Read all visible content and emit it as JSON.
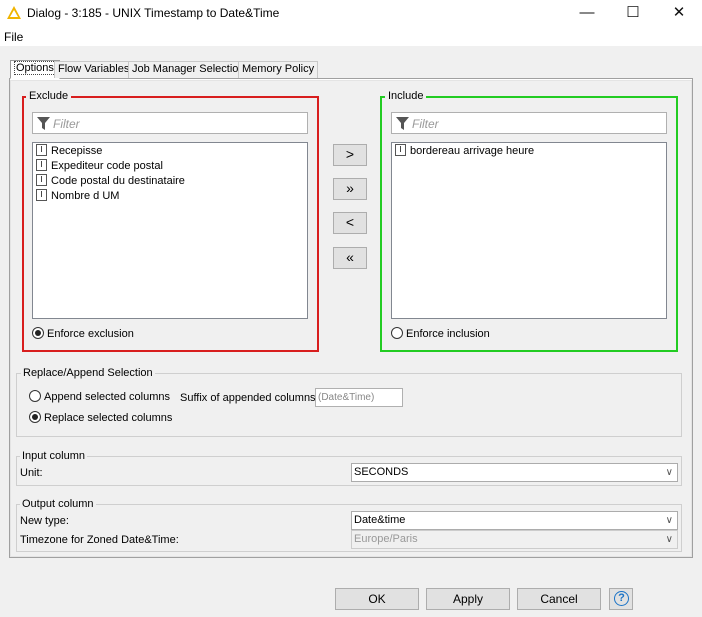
{
  "window": {
    "title": "Dialog - 3:185 - UNIX Timestamp to Date&Time",
    "minimize_glyph": "—",
    "maximize_glyph": "☐",
    "close_glyph": "✕"
  },
  "menu": {
    "file": "File"
  },
  "tabs": [
    {
      "label": "Options",
      "active": true
    },
    {
      "label": "Flow Variables",
      "active": false
    },
    {
      "label": "Job Manager Selection",
      "active": false
    },
    {
      "label": "Memory Policy",
      "active": false
    }
  ],
  "exclude": {
    "legend": "Exclude",
    "filter_placeholder": "Filter",
    "items": [
      "Recepisse",
      "Expediteur code postal",
      "Code postal du destinataire",
      "Nombre d UM"
    ],
    "enforce_label": "Enforce exclusion",
    "enforce_checked": true,
    "border_color": "#d81e1e"
  },
  "include": {
    "legend": "Include",
    "filter_placeholder": "Filter",
    "items": [
      "bordereau arrivage heure"
    ],
    "enforce_label": "Enforce inclusion",
    "enforce_checked": false,
    "border_color": "#22cc22"
  },
  "column_type_glyph": "I",
  "move_buttons": {
    "add": ">",
    "add_all": "»",
    "remove": "<",
    "remove_all": "«"
  },
  "replace_append": {
    "legend": "Replace/Append Selection",
    "append_label": "Append selected columns",
    "replace_label": "Replace selected columns",
    "selected": "replace",
    "suffix_label": "Suffix of appended columns:",
    "suffix_value": "(Date&Time)"
  },
  "input_column": {
    "legend": "Input column",
    "unit_label": "Unit:",
    "unit_value": "SECONDS"
  },
  "output_column": {
    "legend": "Output column",
    "new_type_label": "New type:",
    "new_type_value": "Date&time",
    "timezone_label": "Timezone for Zoned Date&Time:",
    "timezone_value": "Europe/Paris"
  },
  "buttons": {
    "ok": "OK",
    "apply": "Apply",
    "cancel": "Cancel",
    "help": "?"
  },
  "colors": {
    "title_icon": "#f0b400",
    "help_accent": "#1a73c7"
  }
}
